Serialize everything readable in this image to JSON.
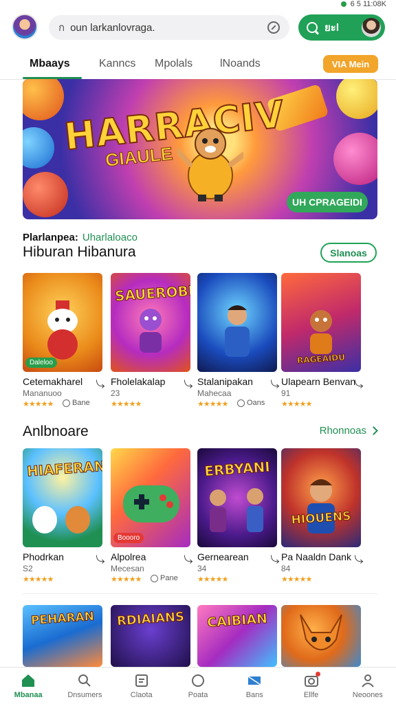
{
  "status": {
    "text": "6 5  11:08K"
  },
  "header": {
    "search_prefix": "ก",
    "search_value": "oun larkanlovraga.",
    "go_label": "ยะl"
  },
  "tabs": [
    {
      "label": "Mbaays",
      "active": true
    },
    {
      "label": "Kanncs",
      "active": false
    },
    {
      "label": "Mpolals",
      "active": false
    },
    {
      "label": "lNoands",
      "active": false
    }
  ],
  "tabs_pill": "VIA Mein",
  "hero": {
    "title": "HARRACIV",
    "subtitle": "GIAULE",
    "cta": "UH CPRAGEIDI"
  },
  "section1": {
    "pre": "Plarlanpea:",
    "pre_green": "Uharlaloaco",
    "title": "Hiburan Hibanura",
    "button": "Slanoas"
  },
  "row1": [
    {
      "name": "Cetemakharel",
      "sub": "Mananuoo",
      "stars": "★★★★★",
      "extra": "Bane",
      "art": "",
      "badge": "Daleloo"
    },
    {
      "name": "Fholelakalap",
      "sub": "23",
      "stars": "★★★★★",
      "extra": "",
      "art": "SAUEROBE",
      "badge": ""
    },
    {
      "name": "Stalanipakan",
      "sub": "Mahecaa",
      "stars": "★★★★★",
      "extra": "Oans",
      "art": "",
      "badge": ""
    },
    {
      "name": "Ulapearn Benvan",
      "sub": "91",
      "stars": "★★★★★",
      "extra": "",
      "art": "RAGEAIDU",
      "badge": ""
    }
  ],
  "section2": {
    "title": "Anlbnoare",
    "link": "Rhonnoas"
  },
  "row2": [
    {
      "name": "Phodrkan",
      "sub": "S2",
      "stars": "★★★★★",
      "extra": "",
      "art": "HIAFERAN",
      "badge": ""
    },
    {
      "name": "Alpolrea",
      "sub": "Mecesan",
      "stars": "★★★★★",
      "extra": "Pane",
      "art": "",
      "badge": "Boooro"
    },
    {
      "name": "Gernearean",
      "sub": "34",
      "stars": "★★★★★",
      "extra": "",
      "art": "ERBYANI",
      "badge": ""
    },
    {
      "name": "Pa Naaldn Dank",
      "sub": "84",
      "stars": "★★★★★",
      "extra": "",
      "art": "HIOUENS",
      "badge": ""
    }
  ],
  "row3": [
    {
      "art": "PEHARAN"
    },
    {
      "art": "RDIAIANS"
    },
    {
      "art": "CAIBIAN"
    },
    {
      "art": ""
    }
  ],
  "bottom_nav": [
    {
      "label": "Mbanaa",
      "icon": "home-icon",
      "active": true
    },
    {
      "label": "Dnsumers",
      "icon": "search-icon",
      "active": false
    },
    {
      "label": "Claota",
      "icon": "document-icon",
      "active": false
    },
    {
      "label": "Poata",
      "icon": "circle-icon",
      "active": false
    },
    {
      "label": "Bans",
      "icon": "flag-icon",
      "active": false
    },
    {
      "label": "Ellfe",
      "icon": "camera-icon",
      "active": false
    },
    {
      "label": "Neoones",
      "icon": "profile-icon",
      "active": false
    }
  ],
  "colors": {
    "accent": "#20a157",
    "pill": "#f2a52b",
    "stars": "#f0a020"
  }
}
